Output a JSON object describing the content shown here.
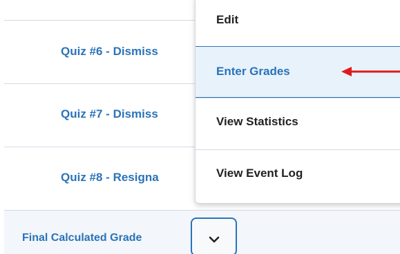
{
  "grade_table": {
    "rows": [
      {
        "label": "Quiz #6 - Dismiss"
      },
      {
        "label": "Quiz #7 - Dismiss"
      },
      {
        "label": "Quiz #8 - Resigna"
      }
    ],
    "final_row": {
      "label": "Final Calculated Grade"
    }
  },
  "context_menu": {
    "items": [
      {
        "label": "Edit"
      },
      {
        "label": "Enter Grades"
      },
      {
        "label": "View Statistics"
      },
      {
        "label": "View Event Log"
      }
    ],
    "highlighted_item": "Enter Grades"
  },
  "annotation": {
    "arrow_color": "#e0191e"
  },
  "colors": {
    "link": "#2a73b8",
    "menu_highlight_bg": "#e8f2fb",
    "row_divider": "#d3d9e3"
  }
}
